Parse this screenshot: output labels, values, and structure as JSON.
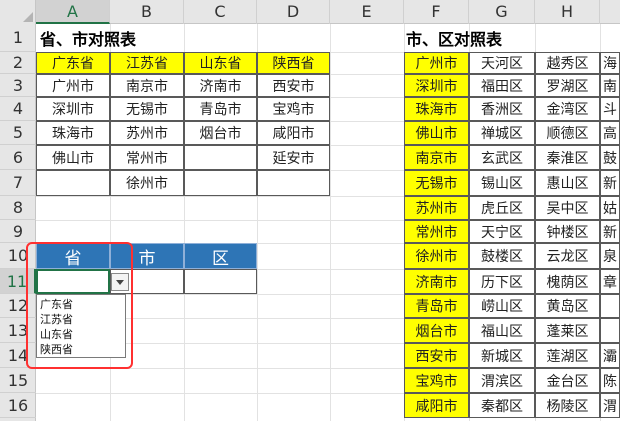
{
  "columns": [
    "A",
    "B",
    "C",
    "D",
    "E",
    "F",
    "G",
    "H"
  ],
  "selected_column": "A",
  "rows": [
    "1",
    "2",
    "3",
    "4",
    "5",
    "6",
    "7",
    "8",
    "9",
    "10",
    "11",
    "12",
    "13",
    "14",
    "15",
    "16"
  ],
  "selected_row": "11",
  "left_table": {
    "title": "省、市对照表",
    "headers": [
      "广东省",
      "江苏省",
      "山东省",
      "陕西省"
    ],
    "rows": [
      [
        "广州市",
        "南京市",
        "济南市",
        "西安市"
      ],
      [
        "深圳市",
        "无锡市",
        "青岛市",
        "宝鸡市"
      ],
      [
        "珠海市",
        "苏州市",
        "烟台市",
        "咸阳市"
      ],
      [
        "佛山市",
        "常州市",
        "",
        "延安市"
      ],
      [
        "",
        "徐州市",
        "",
        ""
      ]
    ]
  },
  "right_table": {
    "title": "市、区对照表",
    "rows": [
      [
        "广州市",
        "天河区",
        "越秀区",
        "海"
      ],
      [
        "深圳市",
        "福田区",
        "罗湖区",
        "南"
      ],
      [
        "珠海市",
        "香洲区",
        "金湾区",
        "斗"
      ],
      [
        "佛山市",
        "禅城区",
        "顺德区",
        "高"
      ],
      [
        "南京市",
        "玄武区",
        "秦淮区",
        "鼓"
      ],
      [
        "无锡市",
        "锡山区",
        "惠山区",
        "新"
      ],
      [
        "苏州市",
        "虎丘区",
        "吴中区",
        "姑"
      ],
      [
        "常州市",
        "天宁区",
        "钟楼区",
        "新"
      ],
      [
        "徐州市",
        "鼓楼区",
        "云龙区",
        "泉"
      ],
      [
        "济南市",
        "历下区",
        "槐荫区",
        "章"
      ],
      [
        "青岛市",
        "崂山区",
        "黄岛区",
        ""
      ],
      [
        "烟台市",
        "福山区",
        "蓬莱区",
        ""
      ],
      [
        "西安市",
        "新城区",
        "莲湖区",
        "灞"
      ],
      [
        "宝鸡市",
        "渭滨区",
        "金台区",
        "陈"
      ],
      [
        "咸阳市",
        "秦都区",
        "杨陵区",
        "渭"
      ]
    ]
  },
  "input_table": {
    "headers": [
      "省",
      "市",
      "区"
    ]
  },
  "dropdown": {
    "options": [
      "广东省",
      "江苏省",
      "山东省",
      "陕西省"
    ]
  },
  "colors": {
    "yellow": "#ffff00",
    "header_blue": "#2e75b6",
    "highlight_red": "#ff3030",
    "excel_green": "#217346"
  }
}
